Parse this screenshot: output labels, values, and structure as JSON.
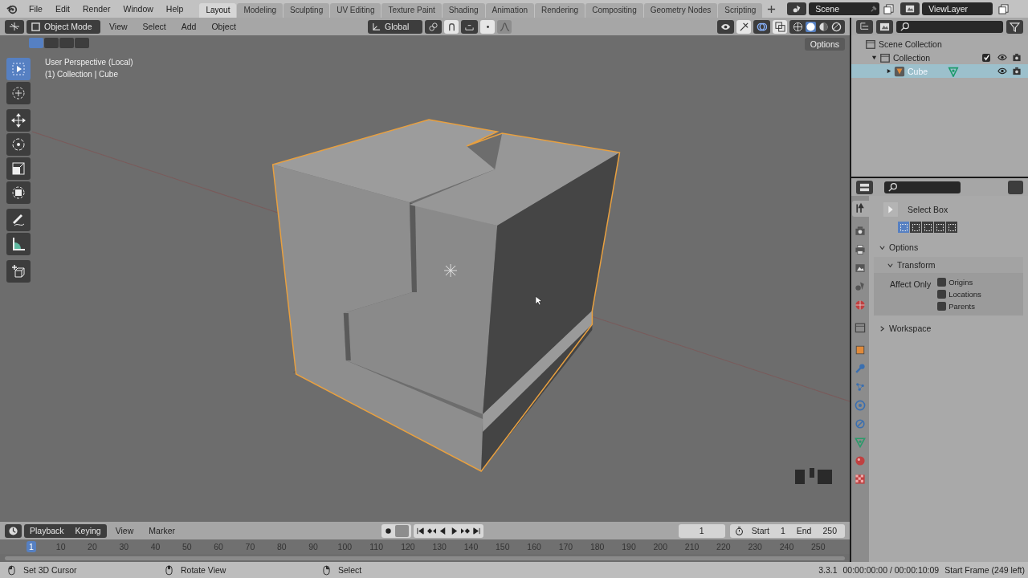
{
  "menu": [
    "File",
    "Edit",
    "Render",
    "Window",
    "Help"
  ],
  "workspace_tabs": [
    {
      "label": "Layout",
      "selected": true
    },
    {
      "label": "Modeling",
      "selected": false
    },
    {
      "label": "Sculpting",
      "selected": false
    },
    {
      "label": "UV Editing",
      "selected": false
    },
    {
      "label": "Texture Paint",
      "selected": false
    },
    {
      "label": "Shading",
      "selected": false
    },
    {
      "label": "Animation",
      "selected": false
    },
    {
      "label": "Rendering",
      "selected": false
    },
    {
      "label": "Compositing",
      "selected": false
    },
    {
      "label": "Geometry Nodes",
      "selected": false
    },
    {
      "label": "Scripting",
      "selected": false
    }
  ],
  "scene": "Scene",
  "view_layer": "ViewLayer",
  "viewport_header": {
    "mode": "Object Mode",
    "menus": [
      "View",
      "Select",
      "Add",
      "Object"
    ],
    "orientation": "Global",
    "shading_modes": [
      {
        "selected": false
      },
      {
        "selected": true
      },
      {
        "selected": false
      },
      {
        "selected": false
      }
    ],
    "select_modes": [
      {
        "selected": true
      },
      {
        "selected": false
      },
      {
        "selected": false
      },
      {
        "selected": false
      }
    ]
  },
  "viewport": {
    "options_button": "Options",
    "overlay_lines": [
      "User Perspective (Local)",
      "(1) Collection | Cube"
    ],
    "tools": [
      {
        "kind": "select_box",
        "selected": true
      },
      {
        "kind": "cursor",
        "selected": false
      },
      {
        "kind": "move",
        "selected": false
      },
      {
        "kind": "rotate",
        "selected": false
      },
      {
        "kind": "scale",
        "selected": false
      },
      {
        "kind": "transform",
        "selected": false
      },
      {
        "kind": "annotate",
        "selected": false
      },
      {
        "kind": "measure",
        "selected": false
      },
      {
        "kind": "add_cube",
        "selected": false
      }
    ]
  },
  "outliner": {
    "items": [
      {
        "kind": "scene_collection",
        "label": "Scene Collection",
        "selected": false,
        "children": [
          {
            "kind": "collection",
            "label": "Collection",
            "selected": false,
            "expanded": true,
            "checked": true,
            "children": [
              {
                "kind": "object",
                "label": "Cube",
                "selected": true,
                "expanded": false
              }
            ]
          }
        ]
      }
    ]
  },
  "properties": {
    "tabs": [
      {
        "kind": "tool",
        "selected": true
      },
      {
        "kind": "render",
        "selected": false
      },
      {
        "kind": "output",
        "selected": false
      },
      {
        "kind": "view_layer",
        "selected": false
      },
      {
        "kind": "scene",
        "selected": false
      },
      {
        "kind": "world",
        "selected": false
      },
      {
        "kind": "collection",
        "selected": false
      },
      {
        "kind": "object",
        "selected": false
      },
      {
        "kind": "modifiers",
        "selected": false
      },
      {
        "kind": "particles",
        "selected": false
      },
      {
        "kind": "physics",
        "selected": false
      },
      {
        "kind": "constraints",
        "selected": false
      },
      {
        "kind": "data",
        "selected": false
      },
      {
        "kind": "material",
        "selected": false
      },
      {
        "kind": "texture",
        "selected": false
      }
    ],
    "tool_name": "Select Box",
    "modes": [
      {
        "selected": true
      },
      {
        "selected": false
      },
      {
        "selected": false
      },
      {
        "selected": false
      },
      {
        "selected": false
      }
    ],
    "options": {
      "title": "Options",
      "expanded": true
    },
    "transform": {
      "title": "Transform",
      "expanded": true
    },
    "affect_only_label": "Affect Only",
    "affect_only": [
      {
        "label": "Origins",
        "checked": false
      },
      {
        "label": "Locations",
        "checked": false
      },
      {
        "label": "Parents",
        "checked": false
      }
    ],
    "workspace": {
      "title": "Workspace",
      "expanded": false
    }
  },
  "timeline": {
    "menus": [
      "Playback",
      "Keying",
      "View",
      "Marker"
    ],
    "current_frame": "1",
    "start_label": "Start",
    "start": "1",
    "end_label": "End",
    "end": "250",
    "ruler": [
      {
        "label": "1",
        "selected": true
      },
      {
        "label": "10",
        "selected": false
      },
      {
        "label": "20",
        "selected": false
      },
      {
        "label": "30",
        "selected": false
      },
      {
        "label": "40",
        "selected": false
      },
      {
        "label": "50",
        "selected": false
      },
      {
        "label": "60",
        "selected": false
      },
      {
        "label": "70",
        "selected": false
      },
      {
        "label": "80",
        "selected": false
      },
      {
        "label": "90",
        "selected": false
      },
      {
        "label": "100",
        "selected": false
      },
      {
        "label": "110",
        "selected": false
      },
      {
        "label": "120",
        "selected": false
      },
      {
        "label": "130",
        "selected": false
      },
      {
        "label": "140",
        "selected": false
      },
      {
        "label": "150",
        "selected": false
      },
      {
        "label": "160",
        "selected": false
      },
      {
        "label": "170",
        "selected": false
      },
      {
        "label": "180",
        "selected": false
      },
      {
        "label": "190",
        "selected": false
      },
      {
        "label": "200",
        "selected": false
      },
      {
        "label": "210",
        "selected": false
      },
      {
        "label": "220",
        "selected": false
      },
      {
        "label": "230",
        "selected": false
      },
      {
        "label": "240",
        "selected": false
      },
      {
        "label": "250",
        "selected": false
      }
    ]
  },
  "status_bar": {
    "hints": [
      "Set 3D Cursor",
      "Rotate View",
      "Select"
    ],
    "version": "3.3.1",
    "time": "00:00:00:00 / 00:00:10:09",
    "frame_info": "Start Frame (249 left)"
  }
}
